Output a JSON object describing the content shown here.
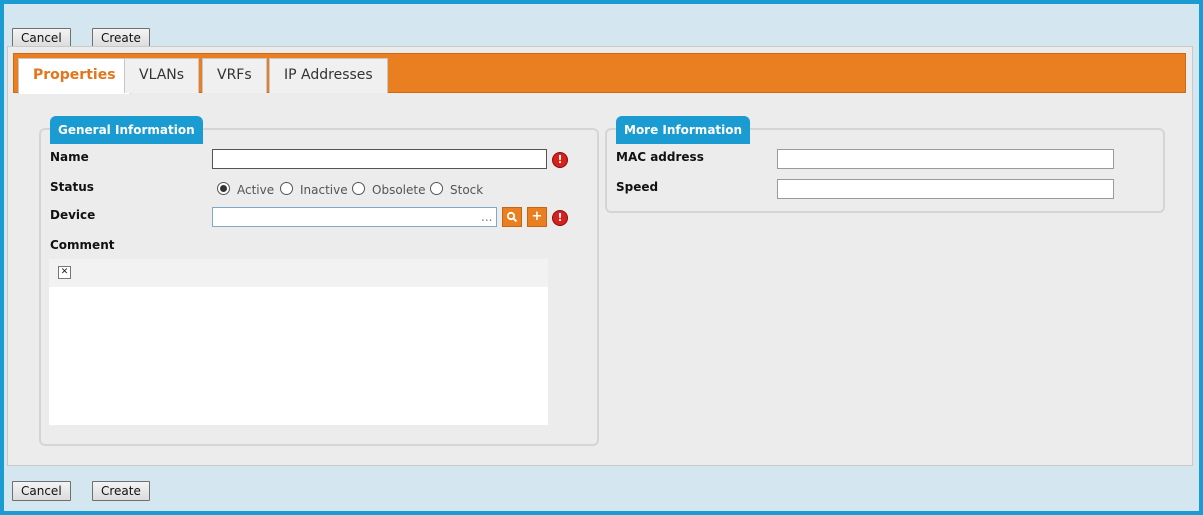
{
  "toolbar_top": {
    "cancel_label": "Cancel",
    "create_label": "Create"
  },
  "toolbar_bottom": {
    "cancel_label": "Cancel",
    "create_label": "Create"
  },
  "tabs": [
    {
      "label": "Properties",
      "active": true
    },
    {
      "label": "VLANs",
      "active": false
    },
    {
      "label": "VRFs",
      "active": false
    },
    {
      "label": "IP Addresses",
      "active": false
    }
  ],
  "general": {
    "legend": "General Information",
    "name_label": "Name",
    "name_value": "",
    "status_label": "Status",
    "status_options": [
      "Active",
      "Inactive",
      "Obsolete",
      "Stock"
    ],
    "status_selected": "Active",
    "device_label": "Device",
    "device_value": "",
    "device_browse": "...",
    "comment_label": "Comment"
  },
  "more": {
    "legend": "More Information",
    "mac_label": "MAC address",
    "mac_value": "",
    "speed_label": "Speed",
    "speed_value": ""
  },
  "icons": {
    "error": "exclamation-icon",
    "search": "magnifier-icon",
    "add": "plus-icon",
    "editor_expand": "expand-icon"
  },
  "colors": {
    "frame_border": "#1a9bd1",
    "tabbar": "#ea7f21",
    "legend": "#1a9bd1",
    "error": "#d8201c"
  }
}
